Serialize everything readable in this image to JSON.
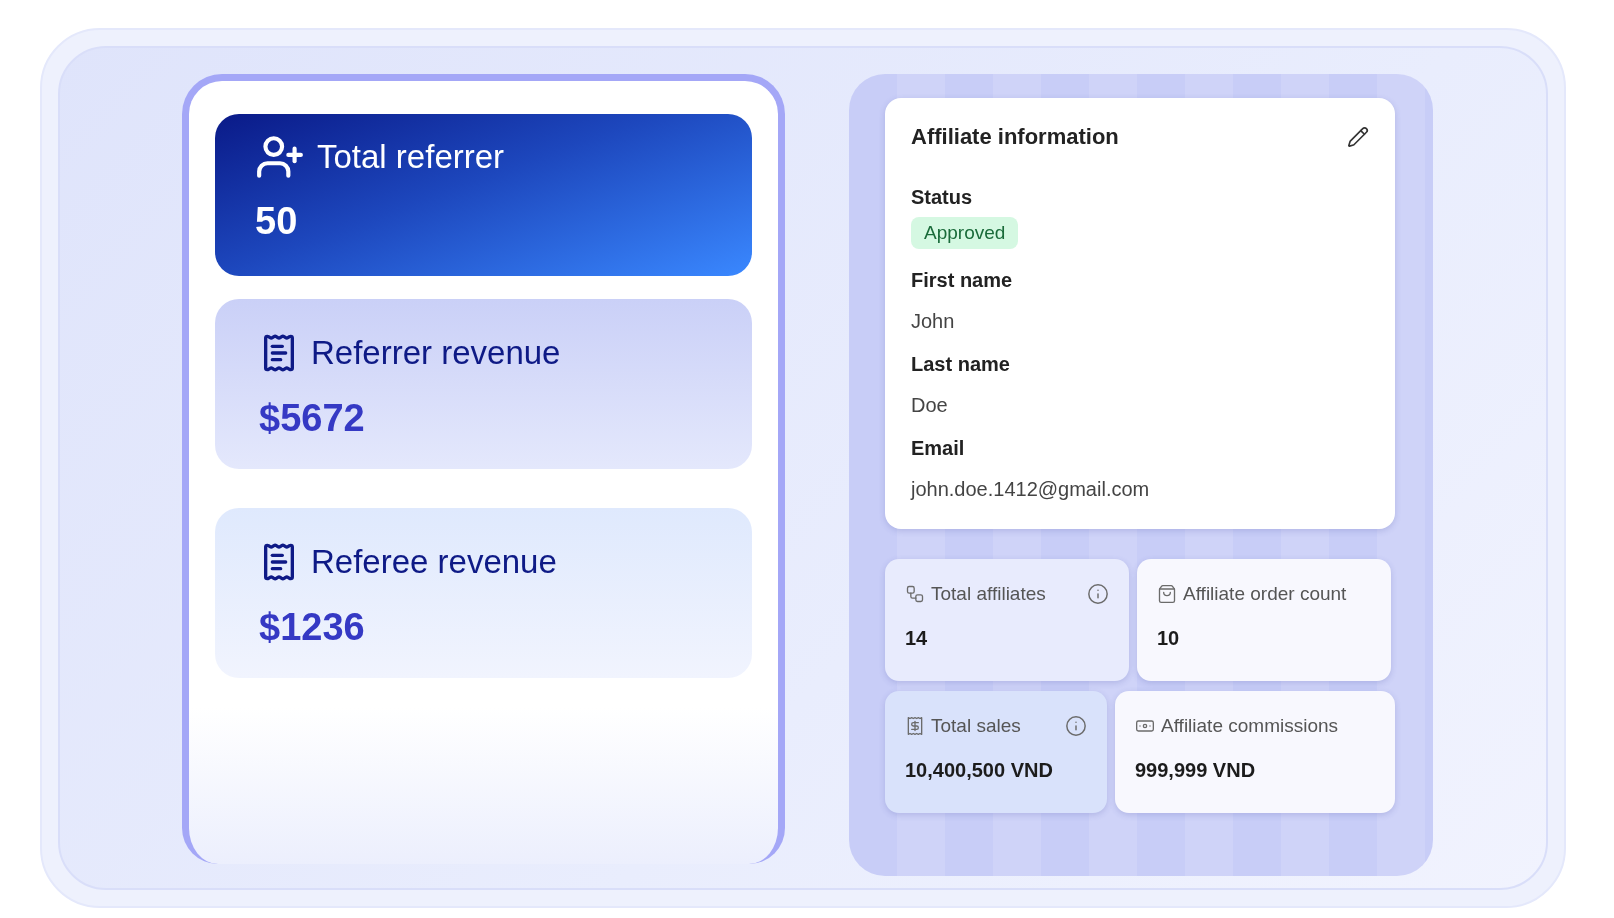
{
  "summary_cards": [
    {
      "kind": "primary",
      "title": "Total referrer",
      "value": "50"
    },
    {
      "kind": "secondary",
      "title": "Referrer revenue",
      "value": "$5672"
    },
    {
      "kind": "tertiary",
      "title": "Referee revenue",
      "value": "$1236"
    }
  ],
  "affiliate_info": {
    "title": "Affiliate information",
    "fields": [
      {
        "kind": "badge",
        "label": "Status",
        "value": "Approved"
      },
      {
        "kind": "text",
        "label": "First name",
        "value": "John"
      },
      {
        "kind": "text",
        "label": "Last name",
        "value": "Doe"
      },
      {
        "kind": "text",
        "label": "Email",
        "value": "john.doe.1412@gmail.com"
      }
    ]
  },
  "stats": [
    {
      "label": "Total affiliates",
      "value": "14",
      "info": true
    },
    {
      "label": "Affiliate order count",
      "value": "10",
      "info": false
    },
    {
      "label": "Total sales",
      "value": "10,400,500 VND",
      "info": true
    },
    {
      "label": "Affiliate commissions",
      "value": "999,999 VND",
      "info": false
    }
  ]
}
